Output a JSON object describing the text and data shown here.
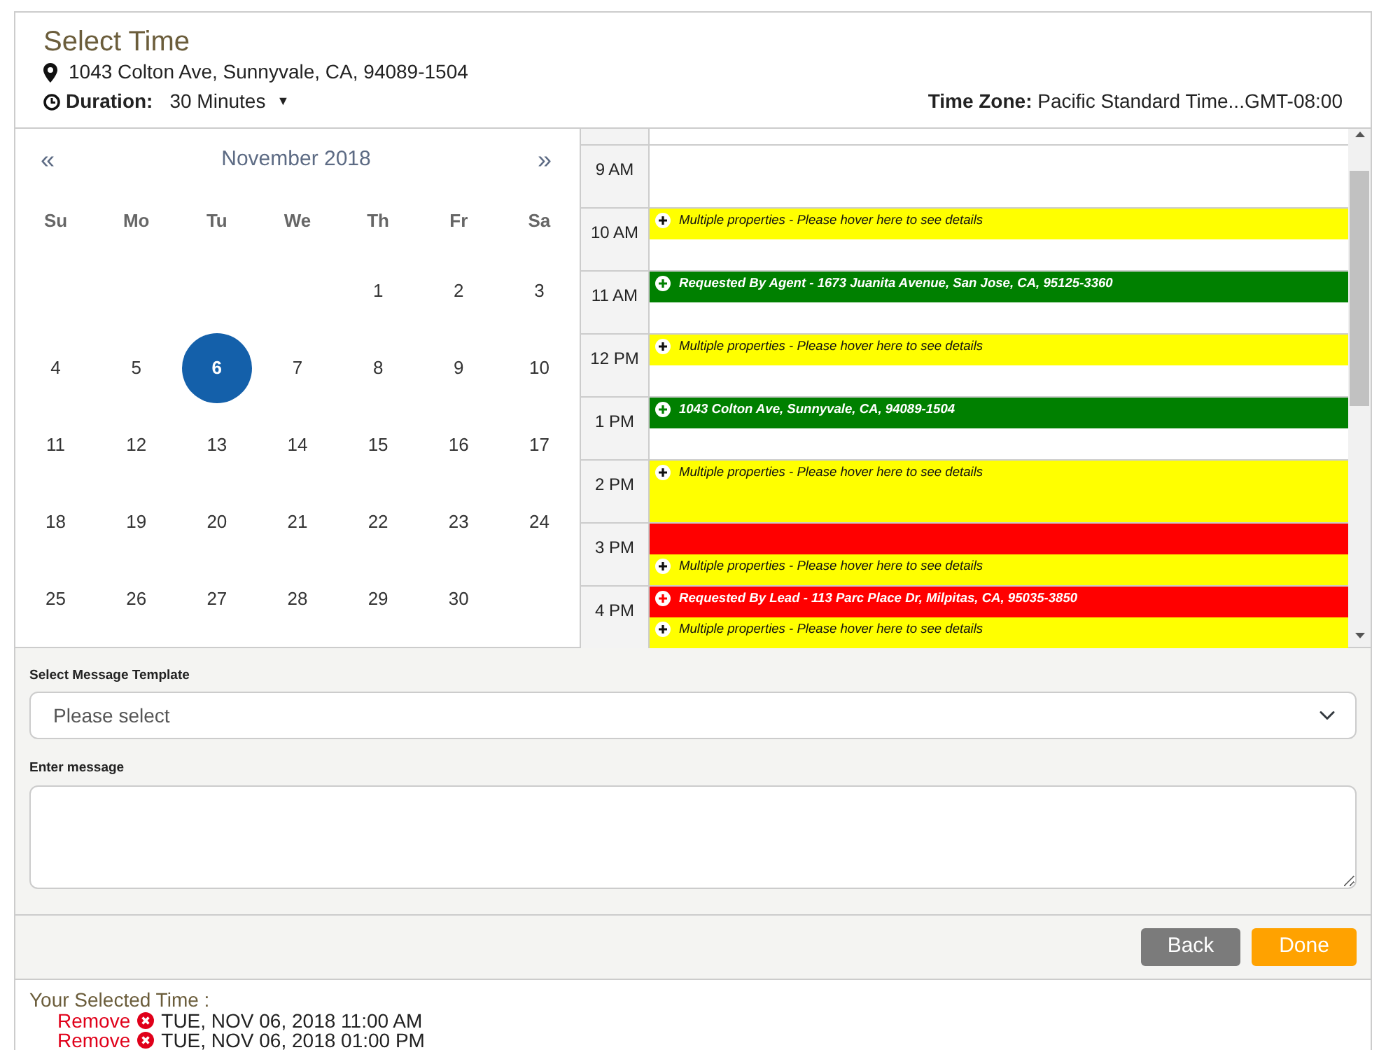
{
  "header": {
    "title": "Select Time",
    "address": "1043 Colton Ave, Sunnyvale, CA, 94089-1504",
    "duration_label": "Duration:",
    "duration_value": "30 Minutes",
    "dropdown_caret": "▼",
    "time_zone_label": "Time Zone:",
    "time_zone_value": "Pacific Standard Time...GMT-08:00"
  },
  "calendar": {
    "prev": "«",
    "month": "November 2018",
    "next": "»",
    "weekdays": [
      "Su",
      "Mo",
      "Tu",
      "We",
      "Th",
      "Fr",
      "Sa"
    ],
    "weeks": [
      {
        "days": [
          {
            "kind": "blank"
          },
          {
            "kind": "blank"
          },
          {
            "kind": "blank"
          },
          {
            "kind": "blank"
          },
          {
            "kind": "day",
            "label": "1",
            "selected": false
          },
          {
            "label": "2",
            "selected": false
          },
          {
            "label": "3",
            "selected": false
          }
        ]
      },
      {
        "days": [
          {
            "label": "4",
            "selected": false
          },
          {
            "label": "5",
            "selected": false
          },
          {
            "label": "6",
            "selected": true
          },
          {
            "label": "7",
            "selected": false
          },
          {
            "label": "8",
            "selected": false
          },
          {
            "label": "9",
            "selected": false
          },
          {
            "label": "10",
            "selected": false
          }
        ]
      },
      {
        "days": [
          {
            "label": "11",
            "selected": false
          },
          {
            "label": "12",
            "selected": false
          },
          {
            "label": "13",
            "selected": false
          },
          {
            "label": "14",
            "selected": false
          },
          {
            "label": "15",
            "selected": false
          },
          {
            "label": "16",
            "selected": false
          },
          {
            "label": "17",
            "selected": false
          }
        ]
      },
      {
        "days": [
          {
            "label": "18",
            "selected": false
          },
          {
            "label": "19",
            "selected": false
          },
          {
            "label": "20",
            "selected": false
          },
          {
            "label": "21",
            "selected": false
          },
          {
            "label": "22",
            "selected": false
          },
          {
            "label": "23",
            "selected": false
          },
          {
            "label": "24",
            "selected": false
          }
        ]
      },
      {
        "days": [
          {
            "label": "25",
            "selected": false
          },
          {
            "label": "26",
            "selected": false
          },
          {
            "label": "27",
            "selected": false
          },
          {
            "label": "28",
            "selected": false
          },
          {
            "label": "29",
            "selected": false
          },
          {
            "label": "30",
            "selected": false
          }
        ]
      }
    ]
  },
  "schedule": {
    "hours": [
      {
        "label": "9 AM",
        "slots": [
          {
            "kind": "free"
          },
          {
            "kind": "free"
          }
        ]
      },
      {
        "label": "10 AM",
        "slots": [
          {
            "kind": "booked",
            "color": "#ffff00",
            "text": "Multiple properties - Please hover here to see details"
          },
          {
            "kind": "free"
          }
        ]
      },
      {
        "label": "11 AM",
        "slots": [
          {
            "kind": "booked",
            "color": "#008000",
            "text": "Requested By Agent - 1673 Juanita Avenue, San Jose, CA, 95125-3360"
          },
          {
            "kind": "free"
          }
        ]
      },
      {
        "label": "12 PM",
        "slots": [
          {
            "kind": "booked",
            "color": "#ffff00",
            "text": "Multiple properties - Please hover here to see details"
          },
          {
            "kind": "free"
          }
        ]
      },
      {
        "label": "1 PM",
        "slots": [
          {
            "kind": "booked",
            "color": "#008000",
            "text": "1043 Colton Ave, Sunnyvale, CA, 94089-1504"
          },
          {
            "kind": "free"
          }
        ]
      },
      {
        "label": "2 PM",
        "slots": [
          {
            "kind": "booked",
            "color": "#ffff00",
            "text": "Multiple properties - Please hover here to see details"
          },
          {
            "kind": "blocked",
            "color": "#ffff00"
          }
        ]
      },
      {
        "label": "3 PM",
        "slots": [
          {
            "kind": "blocked",
            "color": "#ff0000"
          },
          {
            "kind": "booked",
            "color": "#ffff00",
            "text": "Multiple properties - Please hover here to see details"
          }
        ]
      },
      {
        "label": "4 PM",
        "slots": [
          {
            "kind": "booked",
            "color": "#ff0000",
            "text": "Requested By Lead - 113 Parc Place Dr, Milpitas, CA, 95035-3850"
          },
          {
            "kind": "booked",
            "color": "#ffff00",
            "text": "Multiple properties - Please hover here to see details"
          }
        ]
      }
    ]
  },
  "template": {
    "label": "Select Message Template",
    "placeholder": "Please select"
  },
  "message": {
    "label": "Enter message"
  },
  "buttons": [
    "Back",
    "Done"
  ],
  "selected_times": {
    "title": "Your Selected Time :",
    "items": [
      {
        "action": "Remove",
        "time": "TUE, NOV 06, 2018 11:00 AM"
      },
      {
        "action": "Remove",
        "time": "TUE, NOV 06, 2018 01:00 PM"
      }
    ]
  }
}
